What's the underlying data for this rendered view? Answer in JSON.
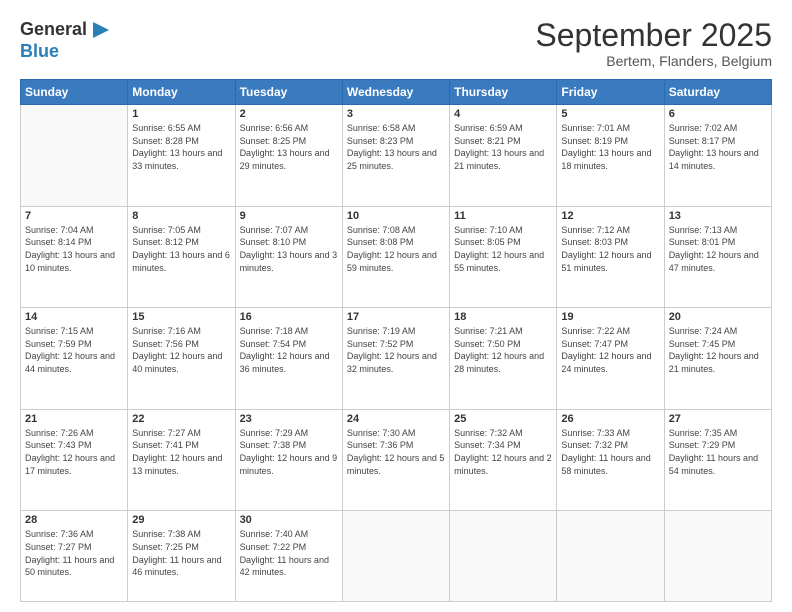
{
  "logo": {
    "general": "General",
    "blue": "Blue"
  },
  "title": "September 2025",
  "subtitle": "Bertem, Flanders, Belgium",
  "days_of_week": [
    "Sunday",
    "Monday",
    "Tuesday",
    "Wednesday",
    "Thursday",
    "Friday",
    "Saturday"
  ],
  "weeks": [
    [
      {
        "day": "",
        "sunrise": "",
        "sunset": "",
        "daylight": ""
      },
      {
        "day": "1",
        "sunrise": "Sunrise: 6:55 AM",
        "sunset": "Sunset: 8:28 PM",
        "daylight": "Daylight: 13 hours and 33 minutes."
      },
      {
        "day": "2",
        "sunrise": "Sunrise: 6:56 AM",
        "sunset": "Sunset: 8:25 PM",
        "daylight": "Daylight: 13 hours and 29 minutes."
      },
      {
        "day": "3",
        "sunrise": "Sunrise: 6:58 AM",
        "sunset": "Sunset: 8:23 PM",
        "daylight": "Daylight: 13 hours and 25 minutes."
      },
      {
        "day": "4",
        "sunrise": "Sunrise: 6:59 AM",
        "sunset": "Sunset: 8:21 PM",
        "daylight": "Daylight: 13 hours and 21 minutes."
      },
      {
        "day": "5",
        "sunrise": "Sunrise: 7:01 AM",
        "sunset": "Sunset: 8:19 PM",
        "daylight": "Daylight: 13 hours and 18 minutes."
      },
      {
        "day": "6",
        "sunrise": "Sunrise: 7:02 AM",
        "sunset": "Sunset: 8:17 PM",
        "daylight": "Daylight: 13 hours and 14 minutes."
      }
    ],
    [
      {
        "day": "7",
        "sunrise": "Sunrise: 7:04 AM",
        "sunset": "Sunset: 8:14 PM",
        "daylight": "Daylight: 13 hours and 10 minutes."
      },
      {
        "day": "8",
        "sunrise": "Sunrise: 7:05 AM",
        "sunset": "Sunset: 8:12 PM",
        "daylight": "Daylight: 13 hours and 6 minutes."
      },
      {
        "day": "9",
        "sunrise": "Sunrise: 7:07 AM",
        "sunset": "Sunset: 8:10 PM",
        "daylight": "Daylight: 13 hours and 3 minutes."
      },
      {
        "day": "10",
        "sunrise": "Sunrise: 7:08 AM",
        "sunset": "Sunset: 8:08 PM",
        "daylight": "Daylight: 12 hours and 59 minutes."
      },
      {
        "day": "11",
        "sunrise": "Sunrise: 7:10 AM",
        "sunset": "Sunset: 8:05 PM",
        "daylight": "Daylight: 12 hours and 55 minutes."
      },
      {
        "day": "12",
        "sunrise": "Sunrise: 7:12 AM",
        "sunset": "Sunset: 8:03 PM",
        "daylight": "Daylight: 12 hours and 51 minutes."
      },
      {
        "day": "13",
        "sunrise": "Sunrise: 7:13 AM",
        "sunset": "Sunset: 8:01 PM",
        "daylight": "Daylight: 12 hours and 47 minutes."
      }
    ],
    [
      {
        "day": "14",
        "sunrise": "Sunrise: 7:15 AM",
        "sunset": "Sunset: 7:59 PM",
        "daylight": "Daylight: 12 hours and 44 minutes."
      },
      {
        "day": "15",
        "sunrise": "Sunrise: 7:16 AM",
        "sunset": "Sunset: 7:56 PM",
        "daylight": "Daylight: 12 hours and 40 minutes."
      },
      {
        "day": "16",
        "sunrise": "Sunrise: 7:18 AM",
        "sunset": "Sunset: 7:54 PM",
        "daylight": "Daylight: 12 hours and 36 minutes."
      },
      {
        "day": "17",
        "sunrise": "Sunrise: 7:19 AM",
        "sunset": "Sunset: 7:52 PM",
        "daylight": "Daylight: 12 hours and 32 minutes."
      },
      {
        "day": "18",
        "sunrise": "Sunrise: 7:21 AM",
        "sunset": "Sunset: 7:50 PM",
        "daylight": "Daylight: 12 hours and 28 minutes."
      },
      {
        "day": "19",
        "sunrise": "Sunrise: 7:22 AM",
        "sunset": "Sunset: 7:47 PM",
        "daylight": "Daylight: 12 hours and 24 minutes."
      },
      {
        "day": "20",
        "sunrise": "Sunrise: 7:24 AM",
        "sunset": "Sunset: 7:45 PM",
        "daylight": "Daylight: 12 hours and 21 minutes."
      }
    ],
    [
      {
        "day": "21",
        "sunrise": "Sunrise: 7:26 AM",
        "sunset": "Sunset: 7:43 PM",
        "daylight": "Daylight: 12 hours and 17 minutes."
      },
      {
        "day": "22",
        "sunrise": "Sunrise: 7:27 AM",
        "sunset": "Sunset: 7:41 PM",
        "daylight": "Daylight: 12 hours and 13 minutes."
      },
      {
        "day": "23",
        "sunrise": "Sunrise: 7:29 AM",
        "sunset": "Sunset: 7:38 PM",
        "daylight": "Daylight: 12 hours and 9 minutes."
      },
      {
        "day": "24",
        "sunrise": "Sunrise: 7:30 AM",
        "sunset": "Sunset: 7:36 PM",
        "daylight": "Daylight: 12 hours and 5 minutes."
      },
      {
        "day": "25",
        "sunrise": "Sunrise: 7:32 AM",
        "sunset": "Sunset: 7:34 PM",
        "daylight": "Daylight: 12 hours and 2 minutes."
      },
      {
        "day": "26",
        "sunrise": "Sunrise: 7:33 AM",
        "sunset": "Sunset: 7:32 PM",
        "daylight": "Daylight: 11 hours and 58 minutes."
      },
      {
        "day": "27",
        "sunrise": "Sunrise: 7:35 AM",
        "sunset": "Sunset: 7:29 PM",
        "daylight": "Daylight: 11 hours and 54 minutes."
      }
    ],
    [
      {
        "day": "28",
        "sunrise": "Sunrise: 7:36 AM",
        "sunset": "Sunset: 7:27 PM",
        "daylight": "Daylight: 11 hours and 50 minutes."
      },
      {
        "day": "29",
        "sunrise": "Sunrise: 7:38 AM",
        "sunset": "Sunset: 7:25 PM",
        "daylight": "Daylight: 11 hours and 46 minutes."
      },
      {
        "day": "30",
        "sunrise": "Sunrise: 7:40 AM",
        "sunset": "Sunset: 7:22 PM",
        "daylight": "Daylight: 11 hours and 42 minutes."
      },
      {
        "day": "",
        "sunrise": "",
        "sunset": "",
        "daylight": ""
      },
      {
        "day": "",
        "sunrise": "",
        "sunset": "",
        "daylight": ""
      },
      {
        "day": "",
        "sunrise": "",
        "sunset": "",
        "daylight": ""
      },
      {
        "day": "",
        "sunrise": "",
        "sunset": "",
        "daylight": ""
      }
    ]
  ]
}
